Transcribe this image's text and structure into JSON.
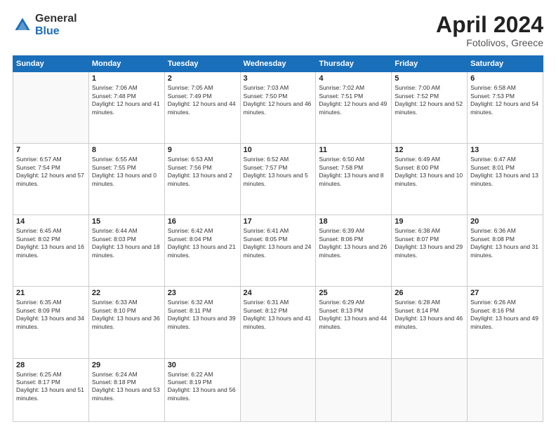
{
  "header": {
    "logo": {
      "general": "General",
      "blue": "Blue"
    },
    "title": "April 2024",
    "location": "Fotolivos, Greece"
  },
  "calendar": {
    "weekdays": [
      "Sunday",
      "Monday",
      "Tuesday",
      "Wednesday",
      "Thursday",
      "Friday",
      "Saturday"
    ],
    "weeks": [
      [
        {
          "day": "",
          "empty": true
        },
        {
          "day": "1",
          "sunrise": "Sunrise: 7:06 AM",
          "sunset": "Sunset: 7:48 PM",
          "daylight": "Daylight: 12 hours and 41 minutes."
        },
        {
          "day": "2",
          "sunrise": "Sunrise: 7:05 AM",
          "sunset": "Sunset: 7:49 PM",
          "daylight": "Daylight: 12 hours and 44 minutes."
        },
        {
          "day": "3",
          "sunrise": "Sunrise: 7:03 AM",
          "sunset": "Sunset: 7:50 PM",
          "daylight": "Daylight: 12 hours and 46 minutes."
        },
        {
          "day": "4",
          "sunrise": "Sunrise: 7:02 AM",
          "sunset": "Sunset: 7:51 PM",
          "daylight": "Daylight: 12 hours and 49 minutes."
        },
        {
          "day": "5",
          "sunrise": "Sunrise: 7:00 AM",
          "sunset": "Sunset: 7:52 PM",
          "daylight": "Daylight: 12 hours and 52 minutes."
        },
        {
          "day": "6",
          "sunrise": "Sunrise: 6:58 AM",
          "sunset": "Sunset: 7:53 PM",
          "daylight": "Daylight: 12 hours and 54 minutes."
        }
      ],
      [
        {
          "day": "7",
          "sunrise": "Sunrise: 6:57 AM",
          "sunset": "Sunset: 7:54 PM",
          "daylight": "Daylight: 12 hours and 57 minutes."
        },
        {
          "day": "8",
          "sunrise": "Sunrise: 6:55 AM",
          "sunset": "Sunset: 7:55 PM",
          "daylight": "Daylight: 13 hours and 0 minutes."
        },
        {
          "day": "9",
          "sunrise": "Sunrise: 6:53 AM",
          "sunset": "Sunset: 7:56 PM",
          "daylight": "Daylight: 13 hours and 2 minutes."
        },
        {
          "day": "10",
          "sunrise": "Sunrise: 6:52 AM",
          "sunset": "Sunset: 7:57 PM",
          "daylight": "Daylight: 13 hours and 5 minutes."
        },
        {
          "day": "11",
          "sunrise": "Sunrise: 6:50 AM",
          "sunset": "Sunset: 7:58 PM",
          "daylight": "Daylight: 13 hours and 8 minutes."
        },
        {
          "day": "12",
          "sunrise": "Sunrise: 6:49 AM",
          "sunset": "Sunset: 8:00 PM",
          "daylight": "Daylight: 13 hours and 10 minutes."
        },
        {
          "day": "13",
          "sunrise": "Sunrise: 6:47 AM",
          "sunset": "Sunset: 8:01 PM",
          "daylight": "Daylight: 13 hours and 13 minutes."
        }
      ],
      [
        {
          "day": "14",
          "sunrise": "Sunrise: 6:45 AM",
          "sunset": "Sunset: 8:02 PM",
          "daylight": "Daylight: 13 hours and 16 minutes."
        },
        {
          "day": "15",
          "sunrise": "Sunrise: 6:44 AM",
          "sunset": "Sunset: 8:03 PM",
          "daylight": "Daylight: 13 hours and 18 minutes."
        },
        {
          "day": "16",
          "sunrise": "Sunrise: 6:42 AM",
          "sunset": "Sunset: 8:04 PM",
          "daylight": "Daylight: 13 hours and 21 minutes."
        },
        {
          "day": "17",
          "sunrise": "Sunrise: 6:41 AM",
          "sunset": "Sunset: 8:05 PM",
          "daylight": "Daylight: 13 hours and 24 minutes."
        },
        {
          "day": "18",
          "sunrise": "Sunrise: 6:39 AM",
          "sunset": "Sunset: 8:06 PM",
          "daylight": "Daylight: 13 hours and 26 minutes."
        },
        {
          "day": "19",
          "sunrise": "Sunrise: 6:38 AM",
          "sunset": "Sunset: 8:07 PM",
          "daylight": "Daylight: 13 hours and 29 minutes."
        },
        {
          "day": "20",
          "sunrise": "Sunrise: 6:36 AM",
          "sunset": "Sunset: 8:08 PM",
          "daylight": "Daylight: 13 hours and 31 minutes."
        }
      ],
      [
        {
          "day": "21",
          "sunrise": "Sunrise: 6:35 AM",
          "sunset": "Sunset: 8:09 PM",
          "daylight": "Daylight: 13 hours and 34 minutes."
        },
        {
          "day": "22",
          "sunrise": "Sunrise: 6:33 AM",
          "sunset": "Sunset: 8:10 PM",
          "daylight": "Daylight: 13 hours and 36 minutes."
        },
        {
          "day": "23",
          "sunrise": "Sunrise: 6:32 AM",
          "sunset": "Sunset: 8:11 PM",
          "daylight": "Daylight: 13 hours and 39 minutes."
        },
        {
          "day": "24",
          "sunrise": "Sunrise: 6:31 AM",
          "sunset": "Sunset: 8:12 PM",
          "daylight": "Daylight: 13 hours and 41 minutes."
        },
        {
          "day": "25",
          "sunrise": "Sunrise: 6:29 AM",
          "sunset": "Sunset: 8:13 PM",
          "daylight": "Daylight: 13 hours and 44 minutes."
        },
        {
          "day": "26",
          "sunrise": "Sunrise: 6:28 AM",
          "sunset": "Sunset: 8:14 PM",
          "daylight": "Daylight: 13 hours and 46 minutes."
        },
        {
          "day": "27",
          "sunrise": "Sunrise: 6:26 AM",
          "sunset": "Sunset: 8:16 PM",
          "daylight": "Daylight: 13 hours and 49 minutes."
        }
      ],
      [
        {
          "day": "28",
          "sunrise": "Sunrise: 6:25 AM",
          "sunset": "Sunset: 8:17 PM",
          "daylight": "Daylight: 13 hours and 51 minutes."
        },
        {
          "day": "29",
          "sunrise": "Sunrise: 6:24 AM",
          "sunset": "Sunset: 8:18 PM",
          "daylight": "Daylight: 13 hours and 53 minutes."
        },
        {
          "day": "30",
          "sunrise": "Sunrise: 6:22 AM",
          "sunset": "Sunset: 8:19 PM",
          "daylight": "Daylight: 13 hours and 56 minutes."
        },
        {
          "day": "",
          "empty": true
        },
        {
          "day": "",
          "empty": true
        },
        {
          "day": "",
          "empty": true
        },
        {
          "day": "",
          "empty": true
        }
      ]
    ]
  }
}
